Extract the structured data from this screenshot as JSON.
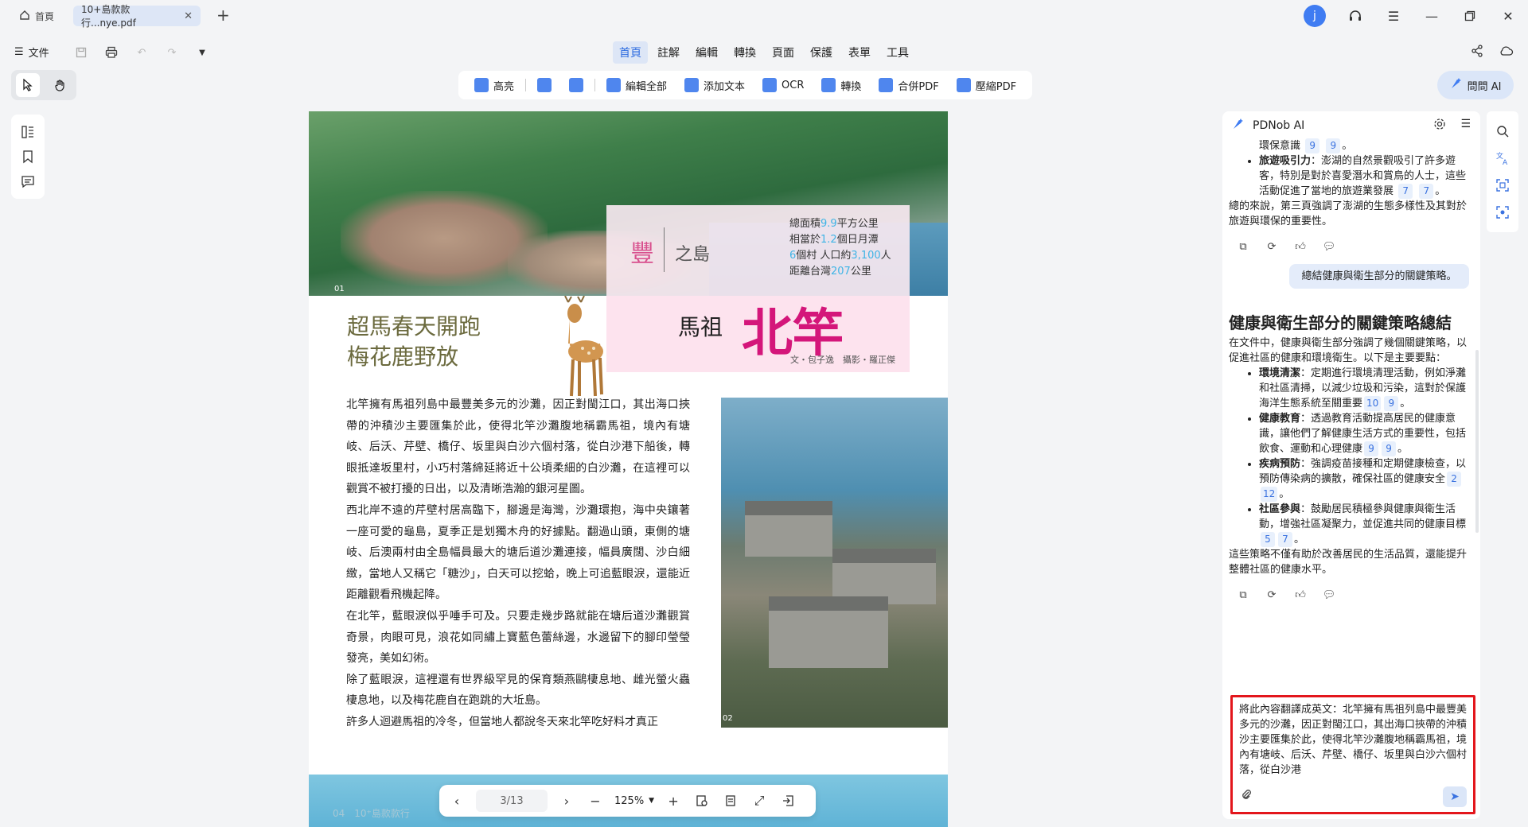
{
  "titlebar": {
    "home_tab": "首頁",
    "file_tab": "10+島款款行...nye.pdf",
    "avatar_letter": "j"
  },
  "menu": {
    "file": "文件",
    "items": [
      "首頁",
      "註解",
      "編輯",
      "轉換",
      "頁面",
      "保護",
      "表單",
      "工具"
    ],
    "active_index": 0
  },
  "toolbar": {
    "highlight": "高亮",
    "edit_all": "編輯全部",
    "add_text": "添加文本",
    "ocr": "OCR",
    "convert": "轉換",
    "merge": "合併PDF",
    "compress": "壓縮PDF"
  },
  "ask_ai": "問問 AI",
  "document": {
    "page_label_1": "01",
    "page_label_2": "02",
    "island_name": "豐",
    "island_suffix": "之島",
    "stats": [
      {
        "pre": "總面積",
        "num": "9.9",
        "post": "平方公里"
      },
      {
        "pre": "相當於",
        "num": "1.2",
        "post": "個日月潭"
      },
      {
        "pre": "",
        "num": "6",
        "post": "個村 人口約",
        "num2": "3,100",
        "post2": "人"
      },
      {
        "pre": "距離台灣",
        "num": "207",
        "post": "公里"
      }
    ],
    "headline_small": "馬祖",
    "headline_big": "北竿",
    "credit": "文・包子逸　攝影・羅正傑",
    "subtitle_line1": "超馬春天開跑",
    "subtitle_line2": "梅花鹿野放",
    "paragraphs": [
      "北竿擁有馬祖列島中最豐美多元的沙灘，因正對閩江口，其出海口挾帶的沖積沙主要匯集於此，使得北竿沙灘腹地稱霸馬祖，境內有塘岐、后沃、芹壁、橋仔、坂里與白沙六個村落，從白沙港下船後，轉眼抵達坂里村，小巧村落綿延將近十公頃柔細的白沙灘，在這裡可以觀賞不被打擾的日出，以及清晰浩瀚的銀河星圖。",
      "西北岸不遠的芹壁村居高臨下，腳邊是海灣，沙灘環抱，海中央鑲著一座可愛的龜島，夏季正是划獨木舟的好據點。翻過山頭，東側的塘岐、后澳兩村由全島幅員最大的塘后道沙灘連接，幅員廣闊、沙白細緻，當地人又稱它「糖沙」，白天可以挖蛤，晚上可追藍眼淚，還能近距離觀看飛機起降。",
      "在北竿，藍眼淚似乎唾手可及。只要走幾步路就能在塘后道沙灘觀賞奇景，肉眼可見，浪花如同繡上寶藍色蕾絲邊，水邊留下的腳印瑩瑩發亮，美如幻術。",
      "除了藍眼淚，這裡還有世界級罕見的保育類燕鷗棲息地、雌光螢火蟲棲息地，以及梅花鹿自在跑跳的大坵島。",
      "許多人迴避馬祖的冷冬，但當地人都說冬天來北竿吃好料才真正"
    ],
    "bottom_page": "04　10⁺島款款行"
  },
  "pagenav": {
    "page": "3/13",
    "zoom": "125%"
  },
  "ai_panel": {
    "title": "PDNob AI",
    "prev_tail": "環保意識",
    "prev_tail_cites": [
      "9",
      "9"
    ],
    "prev_item_label": "旅遊吸引力",
    "prev_item_text": "：澎湖的自然景觀吸引了許多遊客，特別是對於喜愛潛水和賞鳥的人士，這些活動促進了當地的旅遊業發展",
    "prev_item_cites": [
      "7",
      "7"
    ],
    "prev_summary": "總的來說，第三頁強調了澎湖的生態多樣性及其對於旅遊與環保的重要性。",
    "user_msg": "總結健康與衛生部分的關鍵策略。",
    "answer_title": "健康與衛生部分的關鍵策略總結",
    "answer_intro": "在文件中，健康與衛生部分強調了幾個關鍵策略，以促進社區的健康和環境衛生。以下是主要要點：",
    "answer_items": [
      {
        "label": "環境清潔",
        "text": "：定期進行環境清理活動，例如淨灘和社區清掃，以減少垃圾和污染，這對於保護海洋生態系統至關重要",
        "c1": "10",
        "c2": "9"
      },
      {
        "label": "健康教育",
        "text": "：透過教育活動提高居民的健康意識，讓他們了解健康生活方式的重要性，包括飲食、運動和心理健康",
        "c1": "9",
        "c2": "9"
      },
      {
        "label": "疾病預防",
        "text": "：強調疫苗接種和定期健康檢查，以預防傳染病的擴散，確保社區的健康安全",
        "c1": "2",
        "c2": "12"
      },
      {
        "label": "社區參與",
        "text": "：鼓勵居民積極參與健康與衛生活動，增強社區凝聚力，並促進共同的健康目標",
        "c1": "5",
        "c2": "7"
      }
    ],
    "answer_conclusion": "這些策略不僅有助於改善居民的生活品質，還能提升整體社區的健康水平。",
    "input_text": "將此內容翻譯成英文：北竿擁有馬祖列島中最豐美多元的沙灘，因正對閩江口，其出海口挾帶的沖積沙主要匯集於此，使得北竿沙灘腹地稱霸馬祖，境內有塘岐、后沃、芹壁、橋仔、坂里與白沙六個村落，從白沙港"
  },
  "colors": {
    "accent": "#3f7cf2",
    "beigan_pink": "#d4167a",
    "stat_blue": "#3fb4e6",
    "input_border": "#e3161c"
  }
}
